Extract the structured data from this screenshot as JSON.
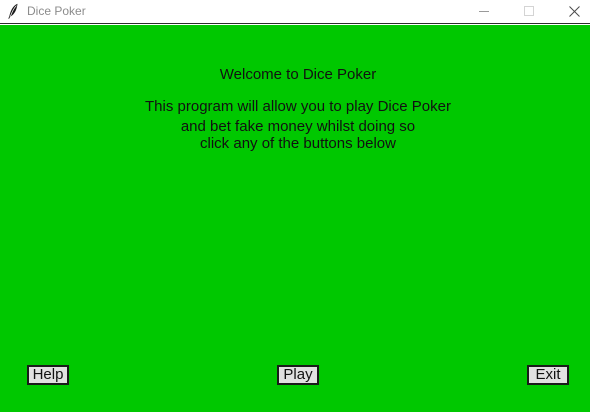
{
  "window": {
    "title": "Dice Poker",
    "icon": "feather-icon",
    "controls": [
      "minimize-icon",
      "maximize-icon",
      "close-icon"
    ]
  },
  "main": {
    "heading": "Welcome to Dice Poker",
    "description_lines": [
      "This program will allow you to play Dice Poker",
      "and bet fake money whilst doing so",
      "click any of the buttons below"
    ]
  },
  "buttons": {
    "help": "Help",
    "play": "Play",
    "exit": "Exit"
  },
  "colors": {
    "background": "#00c800",
    "button_face": "#e1e1e1",
    "text": "#111111"
  }
}
